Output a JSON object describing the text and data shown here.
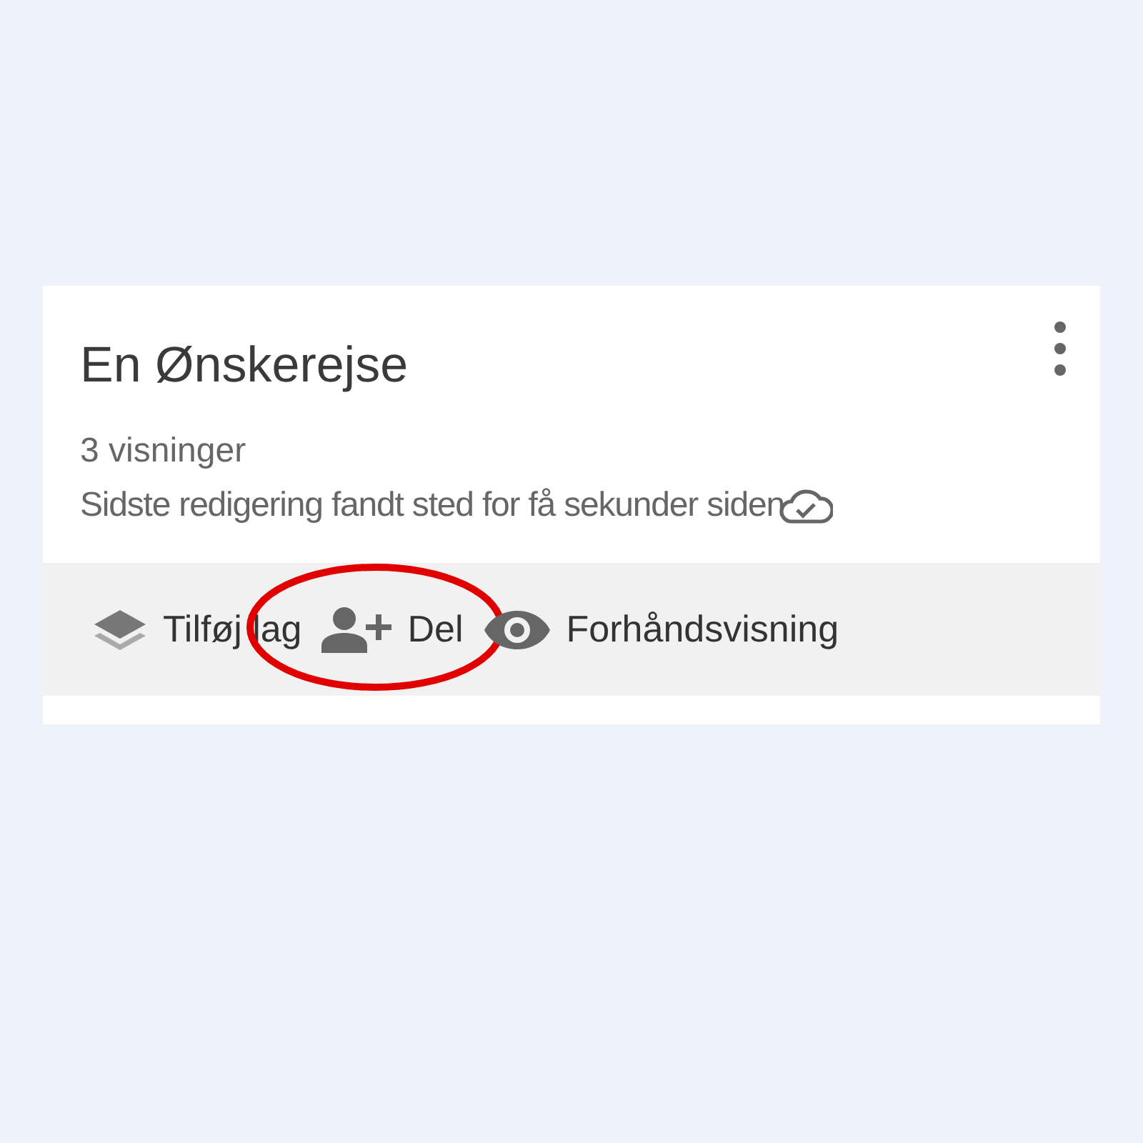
{
  "card": {
    "title": "En Ønskerejse",
    "views": "3 visninger",
    "last_edit": "Sidste redigering fandt sted for få sekunder siden"
  },
  "actions": [
    {
      "kind": "layers",
      "label": "Tilføj lag",
      "highlighted": false
    },
    {
      "kind": "share",
      "label": "Del",
      "highlighted": true
    },
    {
      "kind": "preview",
      "label": "Forhåndsvisning",
      "highlighted": false
    }
  ]
}
